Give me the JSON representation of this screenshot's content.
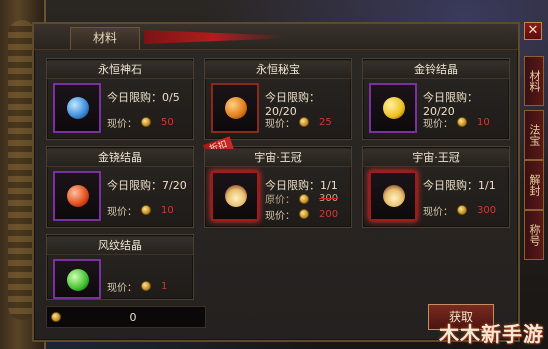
{
  "window": {
    "title": "材料",
    "close_label": "✕"
  },
  "side_tabs": [
    "材料",
    "法宝",
    "解封",
    "称号"
  ],
  "items": [
    {
      "name": "永恒神石",
      "limit": "今日限购：0/5",
      "price_label": "现价：",
      "price": "50",
      "gem_color": "#3a8ad8"
    },
    {
      "name": "永恒秘宝",
      "limit": "今日限购：20/20",
      "price_label": "现价：",
      "price": "25",
      "gem_color": "#e07a18"
    },
    {
      "name": "金铃结晶",
      "limit": "今日限购：20/20",
      "price_label": "现价：",
      "price": "10",
      "gem_color": "#f0c020"
    },
    {
      "name": "金铙结晶",
      "limit": "今日限购：7/20",
      "price_label": "现价：",
      "price": "10",
      "gem_color": "#e04a18"
    },
    {
      "name": "宇宙·王冠",
      "limit": "今日限购：1/1",
      "orig_label": "原价：",
      "orig_price": "300",
      "price_label": "现价：",
      "price": "200",
      "badge": "折扣",
      "gem_color": "#e8c070"
    },
    {
      "name": "宇宙·王冠",
      "limit": "今日限购：1/1",
      "price_label": "现价：",
      "price": "300",
      "gem_color": "#e8c070"
    },
    {
      "name": "风纹结晶",
      "limit": "",
      "price_label": "现价：",
      "price": "1",
      "gem_color": "#40c030"
    }
  ],
  "footer": {
    "gold_amount": "0",
    "get_button": "获取"
  },
  "watermark": "木木新手游"
}
